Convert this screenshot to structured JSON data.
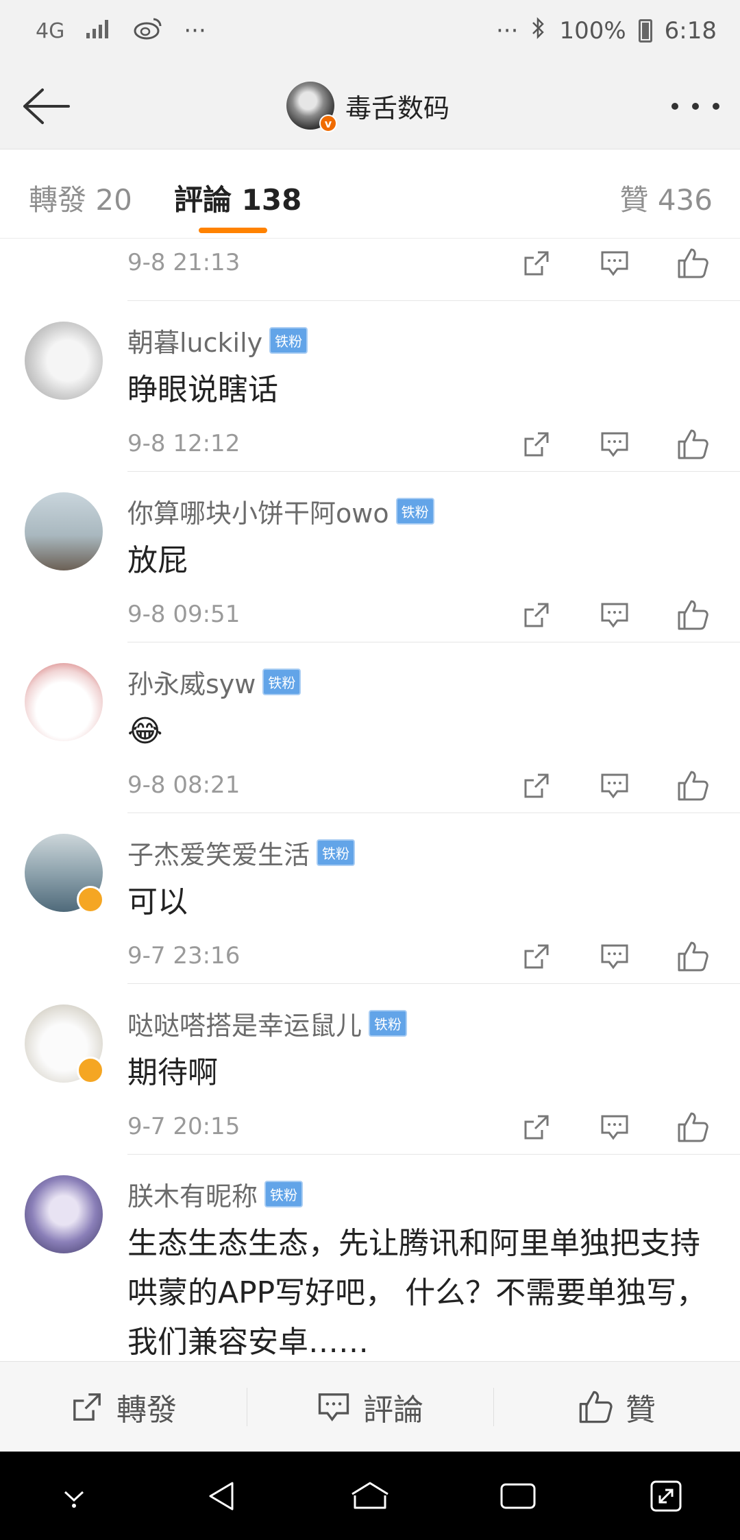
{
  "status_bar": {
    "network": "4G",
    "dots": "···",
    "battery": "100%",
    "time": "6:18"
  },
  "header": {
    "title": "毒舌数码",
    "verified": "v"
  },
  "tabs": {
    "forward": "轉發 20",
    "comments": "評論 138",
    "likes": "贊 436"
  },
  "comments": [
    {
      "name": "",
      "badge": "",
      "text": "",
      "time": "9-8 21:13"
    },
    {
      "name": "朝暮luckily",
      "badge": "铁粉",
      "text": "睁眼说瞎话",
      "time": "9-8 12:12"
    },
    {
      "name": "你算哪块小饼干阿owo",
      "badge": "铁粉",
      "text": "放屁",
      "time": "9-8 09:51"
    },
    {
      "name": "孙永威syw",
      "badge": "铁粉",
      "text": "😂",
      "time": "9-8 08:21"
    },
    {
      "name": "子杰爱笑爱生活",
      "badge": "铁粉",
      "text": "可以",
      "time": "9-7 23:16"
    },
    {
      "name": "哒哒嗒搭是幸运鼠儿",
      "badge": "铁粉",
      "text": "期待啊",
      "time": "9-7 20:15"
    },
    {
      "name": "朕木有昵称",
      "badge": "铁粉",
      "text": "生态生态生态，先让腾讯和阿里单独把支持哄蒙的APP写好吧， 什么？不需要单独写，我们兼容安卓……",
      "time": ""
    }
  ],
  "bottom_bar": {
    "forward": "轉發",
    "comment": "評論",
    "like": "贊"
  },
  "colors": {
    "accent": "#ff8200",
    "badge": "#62a4e8",
    "verified": "#f06b00"
  }
}
